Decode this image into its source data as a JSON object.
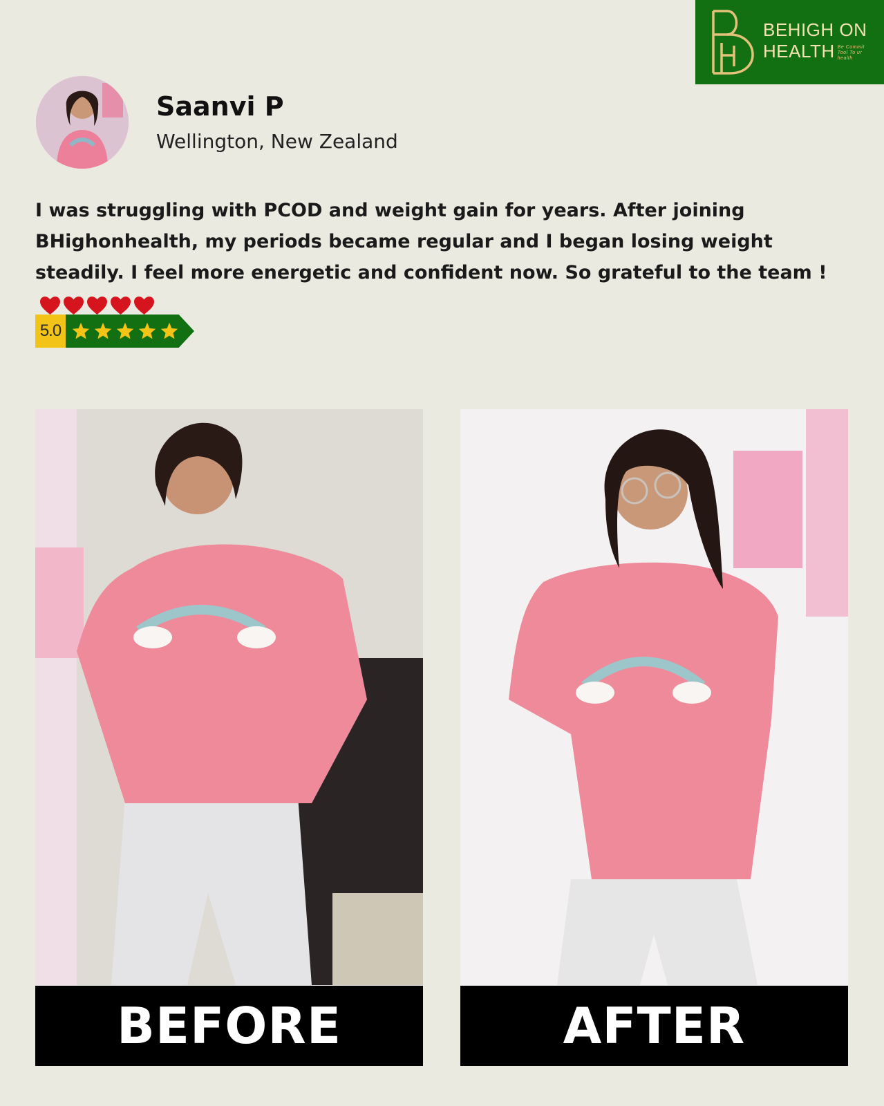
{
  "brand": {
    "name_line1": "BEHIGH ON",
    "name_line2": "HEALTH",
    "tagline": "Be Commit Tool To ur health",
    "colors": {
      "green": "#127012",
      "gold": "#e5c27a"
    }
  },
  "reviewer": {
    "name": "Saanvi P",
    "location": "Wellington, New Zealand"
  },
  "review": {
    "text": "I was struggling with PCOD and weight gain for years. After joining BHighonhealth, my periods became regular and I began losing weight steadily. I feel more energetic and confident now. So grateful to the team !",
    "hearts_count": 5,
    "heart_color": "#d5141e"
  },
  "rating": {
    "score": "5.0",
    "stars": 5,
    "star_color": "#f2c418"
  },
  "photos": {
    "before_label": "BEFORE",
    "after_label": "AFTER"
  }
}
